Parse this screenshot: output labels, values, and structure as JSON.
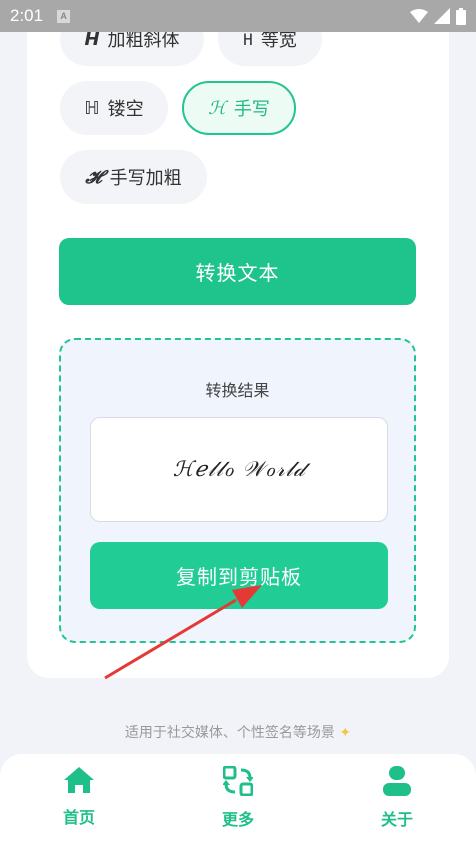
{
  "status_bar": {
    "time": "2:01",
    "notif_icon": "A"
  },
  "styles": {
    "bold_italic": {
      "glyph": "H",
      "label": "加粗斜体"
    },
    "monospace": {
      "glyph": "H",
      "label": "等宽"
    },
    "outline": {
      "glyph": "ℍ",
      "label": "镂空"
    },
    "script": {
      "glyph": "ℋ",
      "label": "手写",
      "selected": true
    },
    "script_bold": {
      "glyph": "𝓗",
      "label": "手写加粗"
    }
  },
  "convert_button": "转换文本",
  "result": {
    "title": "转换结果",
    "output": "ℋℯ𝓁𝓁ℴ 𝒲ℴ𝓇𝓁𝒹",
    "copy_button": "复制到剪贴板"
  },
  "footer_note": "适用于社交媒体、个性签名等场景",
  "nav": {
    "home": "首页",
    "more": "更多",
    "about": "关于"
  },
  "colors": {
    "accent": "#1fc48c",
    "annotation_arrow": "#e53935"
  }
}
